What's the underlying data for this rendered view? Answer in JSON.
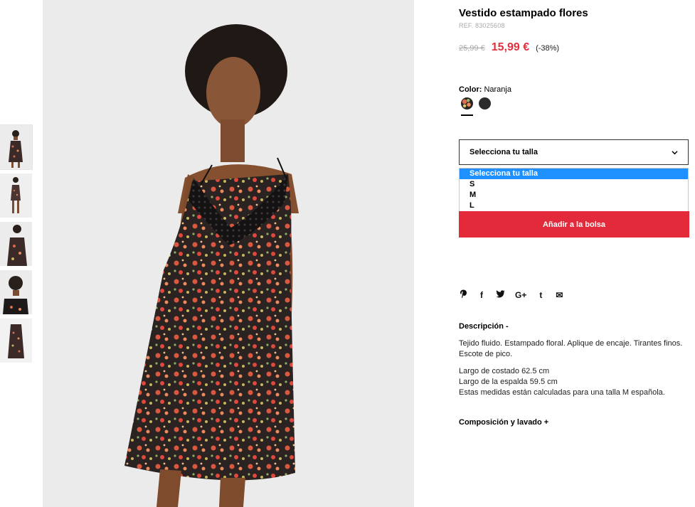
{
  "product": {
    "title": "Vestido estampado flores",
    "ref": "REF. 83025608",
    "price_old": "25,99 €",
    "price_new": "15,99 €",
    "discount": "(-38%)"
  },
  "color": {
    "label": "Color:",
    "value": "Naranja",
    "swatches": [
      "floral",
      "black"
    ]
  },
  "size": {
    "placeholder": "Selecciona tu talla",
    "options": [
      "Selecciona tu talla",
      "S",
      "M",
      "L"
    ],
    "selected_index": 0
  },
  "add_to_bag": "Añadir a la bolsa",
  "social": {
    "pinterest": "P",
    "facebook": "f",
    "twitter": "t",
    "googleplus": "G+",
    "tumblr": "t",
    "email": "✉"
  },
  "description": {
    "title": "Descripción -",
    "text": "Tejido fluido. Estampado floral. Aplique de encaje. Tirantes finos. Escote de pico.",
    "measures": [
      "Largo de costado 62.5 cm",
      "Largo de la espalda 59.5 cm",
      "Estas medidas están calculadas para una talla M española."
    ]
  },
  "composition_title": "Composición y lavado +",
  "colors": {
    "accent": "#e32a3a",
    "price": "#e0303b",
    "dropdown_highlight": "#1e90ff"
  }
}
